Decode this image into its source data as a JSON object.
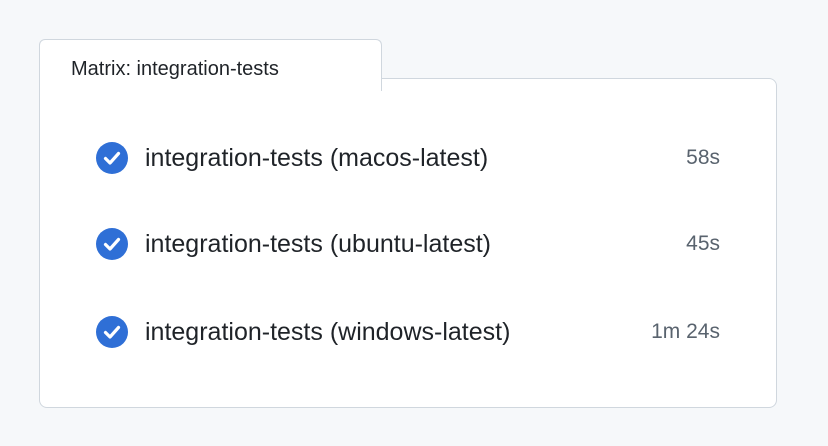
{
  "matrix": {
    "tab_title": "Matrix: integration-tests"
  },
  "jobs": [
    {
      "name": "integration-tests (macos-latest)",
      "duration": "58s",
      "status": "success"
    },
    {
      "name": "integration-tests (ubuntu-latest)",
      "duration": "45s",
      "status": "success"
    },
    {
      "name": "integration-tests (windows-latest)",
      "duration": "1m 24s",
      "status": "success"
    }
  ],
  "icons": {
    "status": "check-circle-fill-icon"
  },
  "colors": {
    "success_icon": "#2f6fd6",
    "text_primary": "#1f2328",
    "text_muted": "#59636e",
    "border": "#d0d7de",
    "page_bg": "#f6f8fa"
  }
}
